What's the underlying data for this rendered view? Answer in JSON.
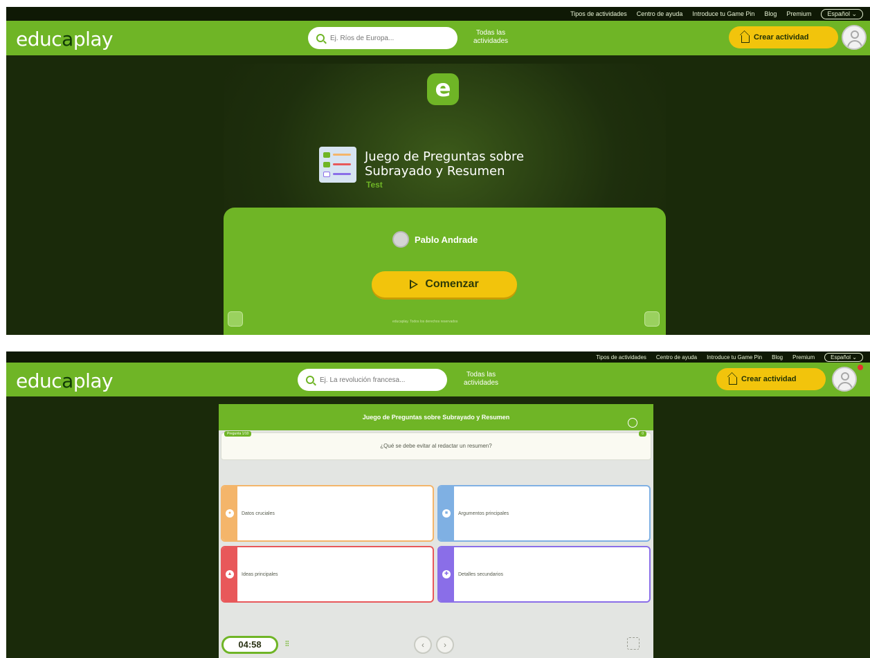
{
  "header": {
    "top_links": [
      "Tipos de actividades",
      "Centro de ayuda",
      "Introduce tu Game Pin",
      "Blog",
      "Premium"
    ],
    "language": "Español",
    "logo_prefix": "educ",
    "logo_o": "a",
    "logo_suffix": "play",
    "all_activities": "Todas las actividades",
    "create_activity": "Crear actividad"
  },
  "screen_start": {
    "search_placeholder": "Ej. Ríos de Europa...",
    "activity_title": "Juego de Preguntas sobre Subrayado y Resumen",
    "activity_type": "Test",
    "author": "Pablo Andrade",
    "start_button": "Comenzar",
    "copyright": "educaplay. Todos los derechos reservados"
  },
  "screen_question": {
    "search_placeholder": "Ej. La revolución francesa...",
    "header_title": "Juego de Preguntas sobre Subrayado y Resumen",
    "question_number": "Pregunta 1/10",
    "points": "0",
    "question": "¿Qué se debe evitar al redactar un resumen?",
    "answers": [
      {
        "label": "Datos cruciales",
        "symbol": "●",
        "color": "#f4b56a"
      },
      {
        "label": "Argumentos principales",
        "symbol": "■",
        "color": "#7fb0e3"
      },
      {
        "label": "Ideas principales",
        "symbol": "▲",
        "color": "#e8585a"
      },
      {
        "label": "Detalles secundarios",
        "symbol": "✚",
        "color": "#8a6ee8"
      }
    ],
    "timer": "04:58",
    "prev": "‹",
    "next": "›"
  },
  "colors": {
    "brand_green": "#6fb526",
    "accent_yellow": "#f2c40c",
    "dark_bg": "#1a2a0a"
  }
}
